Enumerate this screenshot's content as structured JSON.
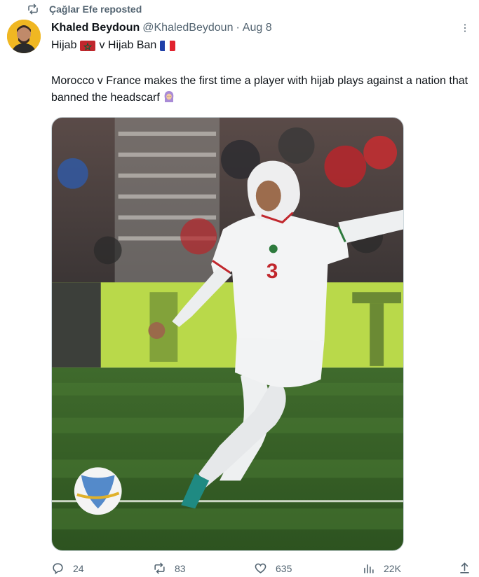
{
  "repost": {
    "text": "Çağlar Efe reposted",
    "icon": "repost-icon"
  },
  "author": {
    "name": "Khaled Beydoun",
    "handle": "@KhaledBeydoun",
    "separator": "·",
    "date": "Aug 8"
  },
  "tweet": {
    "line1_left": "Hijab",
    "line1_mid": "v Hijab Ban",
    "body": "Morocco v France makes the first time a player with hijab plays against a nation that banned the headscarf"
  },
  "media": {
    "player_number": "3",
    "description_icon": "photo"
  },
  "actions": {
    "replies": "24",
    "reposts": "83",
    "likes": "635",
    "views": "22K"
  },
  "colors": {
    "text": "#0f1419",
    "secondary": "#536471",
    "border": "#cfd9de"
  }
}
